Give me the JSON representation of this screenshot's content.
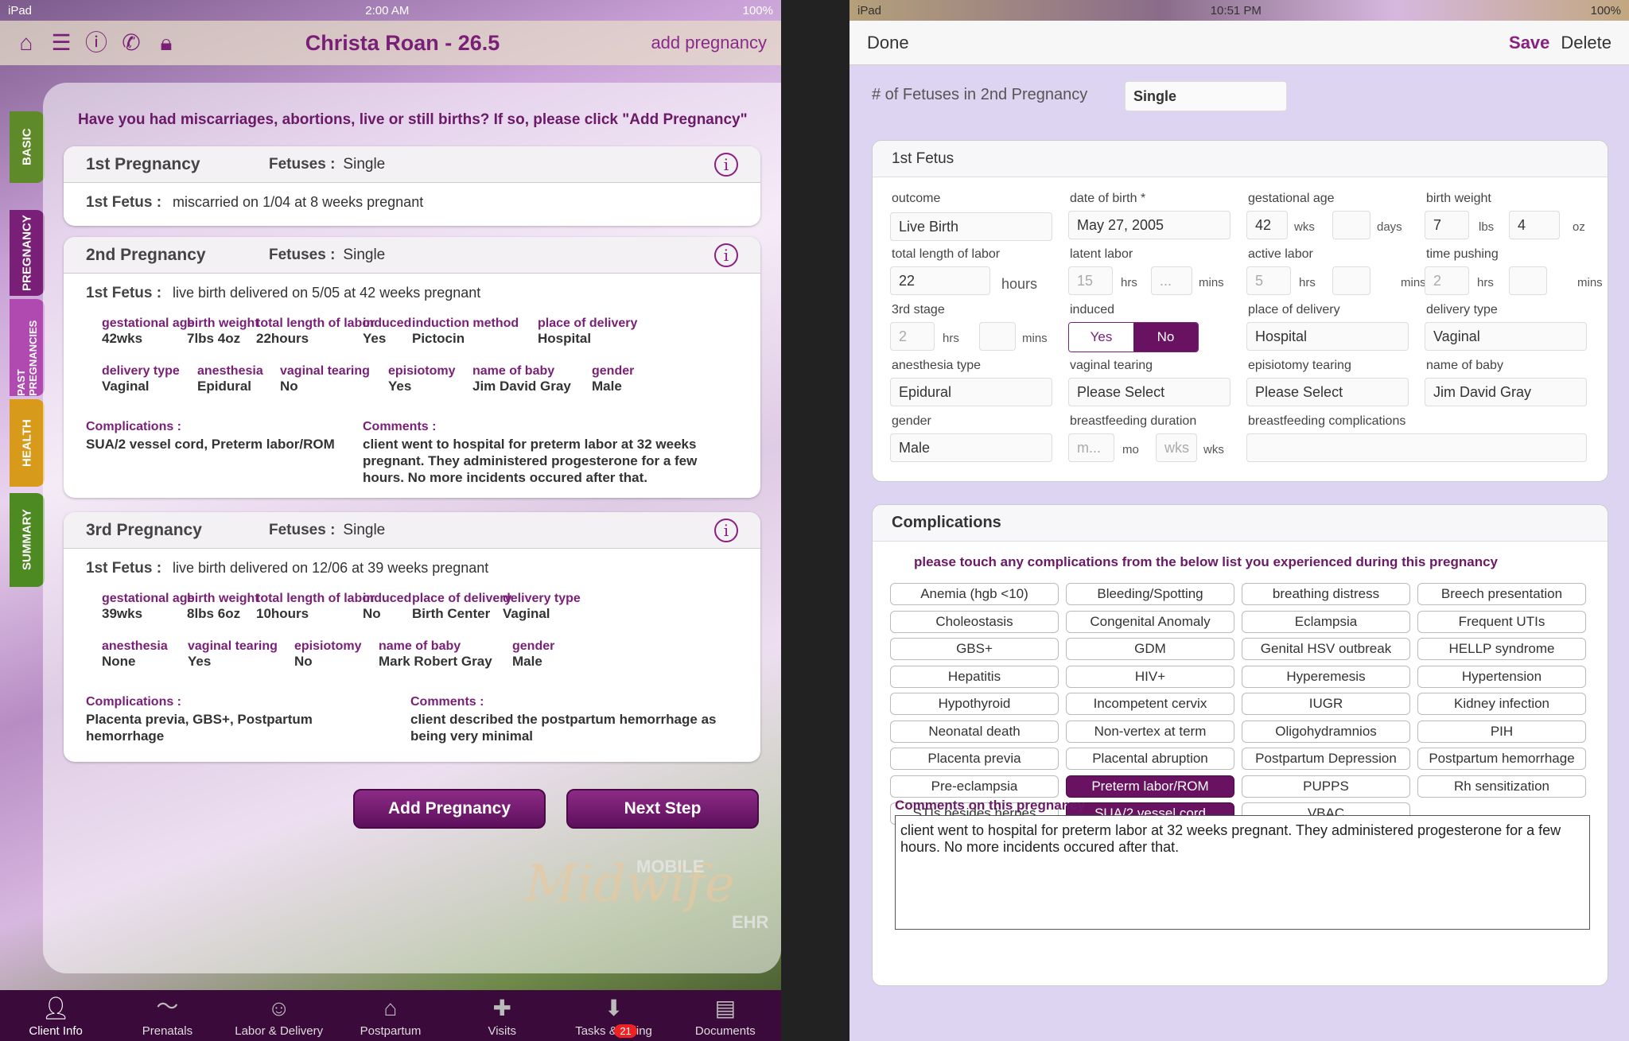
{
  "left": {
    "status": {
      "carrier": "iPad",
      "time": "2:00 AM",
      "battery": "100%"
    },
    "header": {
      "title": "Christa Roan - 26.5",
      "add_link": "add pregnancy"
    },
    "question": "Have you had miscarriages, abortions, live or still births? If so, please click \"Add Pregnancy\"",
    "side_tabs": [
      "BASIC",
      "PREGNANCY",
      "PAST PREGNANCIES",
      "HEALTH",
      "SUMMARY"
    ],
    "fetuses_label": "Fetuses :",
    "fetus_label": "1st Fetus :",
    "complications_label": "Complications :",
    "comments_label": "Comments :",
    "p1": {
      "title": "1st Pregnancy",
      "fetuses": "Single",
      "fetus_desc": "miscarried on 1/04 at 8 weeks pregnant"
    },
    "p2": {
      "title": "2nd Pregnancy",
      "fetuses": "Single",
      "fetus_desc": "live birth delivered on 5/05 at 42 weeks pregnant",
      "f": [
        {
          "k": "gestational age",
          "v": "42wks"
        },
        {
          "k": "birth weight",
          "v": "7lbs 4oz"
        },
        {
          "k": "total length of labor",
          "v": "22hours"
        },
        {
          "k": "induced",
          "v": "Yes"
        },
        {
          "k": "induction method",
          "v": "Pictocin"
        },
        {
          "k": "place of delivery",
          "v": "Hospital"
        },
        {
          "k": "delivery type",
          "v": "Vaginal"
        },
        {
          "k": "anesthesia",
          "v": "Epidural"
        },
        {
          "k": "vaginal tearing",
          "v": "No"
        },
        {
          "k": "episiotomy",
          "v": "Yes"
        },
        {
          "k": "name of baby",
          "v": "Jim David Gray"
        },
        {
          "k": "gender",
          "v": "Male"
        }
      ],
      "complications": "SUA/2 vessel cord, Preterm labor/ROM",
      "comments": "client went to hospital for preterm labor at 32 weeks pregnant.  They administered progesterone for a few hours. No more incidents occured after that."
    },
    "p3": {
      "title": "3rd Pregnancy",
      "fetuses": "Single",
      "fetus_desc": "live birth delivered on 12/06 at 39 weeks pregnant",
      "f": [
        {
          "k": "gestational age",
          "v": "39wks"
        },
        {
          "k": "birth weight",
          "v": "8lbs 6oz"
        },
        {
          "k": "total length of labor",
          "v": "10hours"
        },
        {
          "k": "induced",
          "v": "No"
        },
        {
          "k": "place of delivery",
          "v": "Birth Center"
        },
        {
          "k": "delivery type",
          "v": "Vaginal"
        },
        {
          "k": "anesthesia",
          "v": "None"
        },
        {
          "k": "vaginal tearing",
          "v": "Yes"
        },
        {
          "k": "episiotomy",
          "v": "No"
        },
        {
          "k": "name of baby",
          "v": "Mark Robert Gray"
        },
        {
          "k": "gender",
          "v": "Male"
        }
      ],
      "complications": "Placenta previa, GBS+, Postpartum hemorrhage",
      "comments": "client described the postpartum hemorrhage as being very minimal"
    },
    "buttons": {
      "add": "Add Pregnancy",
      "next": "Next Step"
    },
    "logo": {
      "main": "Midwife",
      "mobile": "MOBILE",
      "ehr": "EHR"
    },
    "tabbar": [
      "Client Info",
      "Prenatals",
      "Labor & Delivery",
      "Postpartum",
      "Visits",
      "Tasks & Billing",
      "Documents"
    ],
    "badge": "21"
  },
  "right": {
    "status": {
      "carrier": "iPad",
      "time": "10:51 PM",
      "battery": "100%"
    },
    "header": {
      "done": "Done",
      "save": "Save",
      "delete": "Delete"
    },
    "fetuses_label": "# of Fetuses in 2nd Pregnancy",
    "fetuses_value": "Single",
    "fetus_card_title": "1st Fetus",
    "labels": {
      "outcome": "outcome",
      "dob": "date of birth *",
      "ga": "gestational age",
      "bw": "birth weight",
      "tll": "total length of labor",
      "latent": "latent labor",
      "active": "active labor",
      "pushing": "time pushing",
      "third": "3rd stage",
      "induced": "induced",
      "place": "place of delivery",
      "dtype": "delivery type",
      "anest": "anesthesia type",
      "vt": "vaginal tearing",
      "et": "episiotomy tearing",
      "name": "name of baby",
      "gender": "gender",
      "bfd": "breastfeeding duration",
      "bfc": "breastfeeding complications"
    },
    "values": {
      "outcome": "Live Birth",
      "dob": "May 27, 2005",
      "ga_wks": "42",
      "bw_lbs": "7",
      "bw_oz": "4",
      "tll": "22",
      "latent_hrs": "15",
      "latent_mins": "...",
      "active_hrs": "5",
      "pushing_hrs": "2",
      "third_hrs": "2",
      "place": "Hospital",
      "dtype": "Vaginal",
      "anest": "Epidural",
      "vt": "Please Select",
      "et": "Please Select",
      "name": "Jim David Gray",
      "gender": "Male",
      "bfd_mo": "m...",
      "bfd_wks": "wks"
    },
    "units": {
      "wks": "wks",
      "days": "days",
      "lbs": "lbs",
      "oz": "oz",
      "hours": "hours",
      "hrs": "hrs",
      "mins": "mins",
      "mo": "mo"
    },
    "induced_opts": {
      "yes": "Yes",
      "no": "No"
    },
    "complications_title": "Complications",
    "complications_prompt": "please touch any complications from the below list you experienced during this pregnancy",
    "complications": [
      "Anemia (hgb <10)",
      "Bleeding/Spotting",
      "breathing distress",
      "Breech presentation",
      "Choleostasis",
      "Congenital Anomaly",
      "Eclampsia",
      "Frequent UTIs",
      "GBS+",
      "GDM",
      "Genital HSV outbreak",
      "HELLP syndrome",
      "Hepatitis",
      "HIV+",
      "Hyperemesis",
      "Hypertension",
      "Hypothyroid",
      "Incompetent cervix",
      "IUGR",
      "Kidney infection",
      "Neonatal death",
      "Non-vertex at term",
      "Oligohydramnios",
      "PIH",
      "Placenta previa",
      "Placental abruption",
      "Postpartum Depression",
      "Postpartum hemorrhage",
      "Pre-eclampsia",
      "Preterm labor/ROM",
      "PUPPS",
      "Rh sensitization",
      "STIs besides herpes",
      "SUA/2 vessel cord",
      "VBAC"
    ],
    "selected": [
      "Preterm labor/ROM",
      "SUA/2 vessel cord"
    ],
    "comments_label": "Comments on this pregnancy",
    "comments": "client went to hospital for preterm labor at 32 weeks pregnant.  They administered progesterone for a few hours. No more incidents occured after that."
  }
}
